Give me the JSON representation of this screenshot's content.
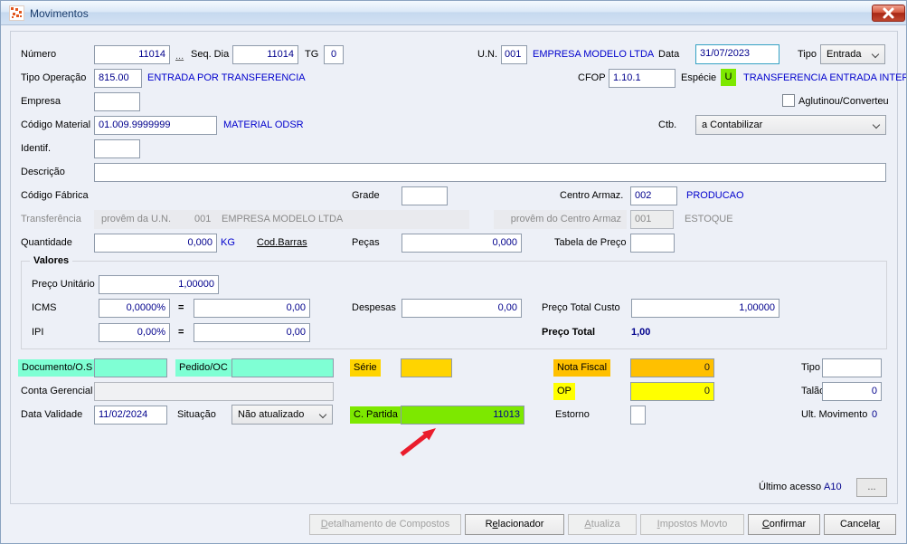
{
  "window": {
    "title": "Movimentos"
  },
  "colors": {
    "accent_teal": "#7FFFD4",
    "accent_gold": "#FFD400",
    "accent_amber": "#FFC000",
    "accent_yellow": "#FFFF00",
    "accent_green": "#7DE800",
    "value_navy": "#00008C",
    "desc_blue": "#0000CD",
    "arrow_red": "#EA1C2C"
  },
  "row1": {
    "numero_label": "Número",
    "numero": "11014",
    "more_link": "...",
    "seq_dia_label": "Seq. Dia",
    "seq_dia": "11014",
    "tg_label": "TG",
    "tg": "0",
    "un_label": "U.N.",
    "un": "001",
    "un_desc": "EMPRESA MODELO LTDA",
    "data_label": "Data",
    "data": "31/07/2023",
    "tipo_label": "Tipo",
    "tipo": "Entrada"
  },
  "row2": {
    "tipo_operacao_label": "Tipo Operação",
    "tipo_operacao": "815.00",
    "tipo_operacao_desc": "ENTRADA POR TRANSFERENCIA",
    "cfop_label": "CFOP",
    "cfop": "1.10.1",
    "especie_label": "Espécie",
    "especie": "U",
    "especie_desc": "TRANSFERENCIA ENTRADA INTERNA"
  },
  "row3": {
    "empresa_label": "Empresa",
    "empresa": "",
    "aglutinou_label": "Aglutinou/Converteu"
  },
  "row4": {
    "codigo_material_label": "Código Material",
    "codigo_material": "01.009.9999999",
    "codigo_material_desc": "MATERIAL ODSR",
    "ctb_label": "Ctb.",
    "ctb": "a Contabilizar"
  },
  "row5": {
    "identif_label": "Identif.",
    "identif": ""
  },
  "row6": {
    "descricao_label": "Descrição",
    "descricao": ""
  },
  "row7": {
    "codigo_fabrica_label": "Código Fábrica",
    "grade_label": "Grade",
    "grade": "",
    "centro_armaz_label": "Centro Armaz.",
    "centro_armaz": "002",
    "centro_armaz_desc": "PRODUCAO"
  },
  "row8": {
    "transferencia_label": "Transferência",
    "provem_un_label": "provêm da U.N.",
    "provem_un": "001",
    "provem_un_desc": "EMPRESA MODELO LTDA",
    "provem_ca_label": "provêm do Centro Armaz",
    "provem_ca": "001",
    "provem_ca_desc": "ESTOQUE"
  },
  "row9": {
    "quantidade_label": "Quantidade",
    "quantidade": "0,000",
    "unidade": "KG",
    "cod_barras_link": "Cod.Barras",
    "pecas_label": "Peças",
    "pecas": "0,000",
    "tabela_preco_label": "Tabela de Preço",
    "tabela_preco": ""
  },
  "valores": {
    "legend": "Valores",
    "preco_unitario_label": "Preço Unitário",
    "preco_unitario": "1,00000",
    "icms_label": "ICMS",
    "icms_pct": "0,0000%",
    "equals": "=",
    "icms_valor": "0,00",
    "ipi_label": "IPI",
    "ipi_pct": "0,00%",
    "ipi_valor": "0,00",
    "despesas_label": "Despesas",
    "despesas": "0,00",
    "preco_total_custo_label": "Preço Total Custo",
    "preco_total_custo": "1,00000",
    "preco_total_label": "Preço Total",
    "preco_total": "1,00"
  },
  "row11": {
    "documento_os_label": "Documento/O.S",
    "documento_os": "",
    "pedido_oc_label": "Pedido/OC",
    "pedido_oc": "",
    "serie_label": "Série",
    "serie": "",
    "nota_fiscal_label": "Nota Fiscal",
    "nota_fiscal": "0",
    "tipo_label": "Tipo",
    "tipo": ""
  },
  "row12": {
    "conta_gerencial_label": "Conta Gerencial",
    "conta_gerencial": "",
    "op_label": "OP",
    "op": "0",
    "talao_label": "Talão",
    "talao": "0"
  },
  "row13": {
    "data_validade_label": "Data Validade",
    "data_validade": "11/02/2024",
    "situacao_label": "Situação",
    "situacao": "Não atualizado",
    "c_partida_label": "C. Partida",
    "c_partida": "11013",
    "estorno_label": "Estorno",
    "ult_movimento_label": "Ult. Movimento",
    "ult_movimento": "0"
  },
  "footer": {
    "ultimo_acesso_label": "Último acesso",
    "ultimo_acesso": "A10",
    "browse_button": "..."
  },
  "buttons": {
    "detalhamento": {
      "pre": "",
      "accel": "D",
      "post": "etalhamento de Compostos"
    },
    "relacionador": {
      "pre": "R",
      "accel": "e",
      "post": "lacionador"
    },
    "atualiza": {
      "pre": "",
      "accel": "A",
      "post": "tualiza"
    },
    "impostos": {
      "pre": "",
      "accel": "I",
      "post": "mpostos Movto"
    },
    "confirmar": {
      "pre": "",
      "accel": "C",
      "post": "onfirmar"
    },
    "cancelar": {
      "pre": "Cancela",
      "accel": "r",
      "post": ""
    }
  }
}
